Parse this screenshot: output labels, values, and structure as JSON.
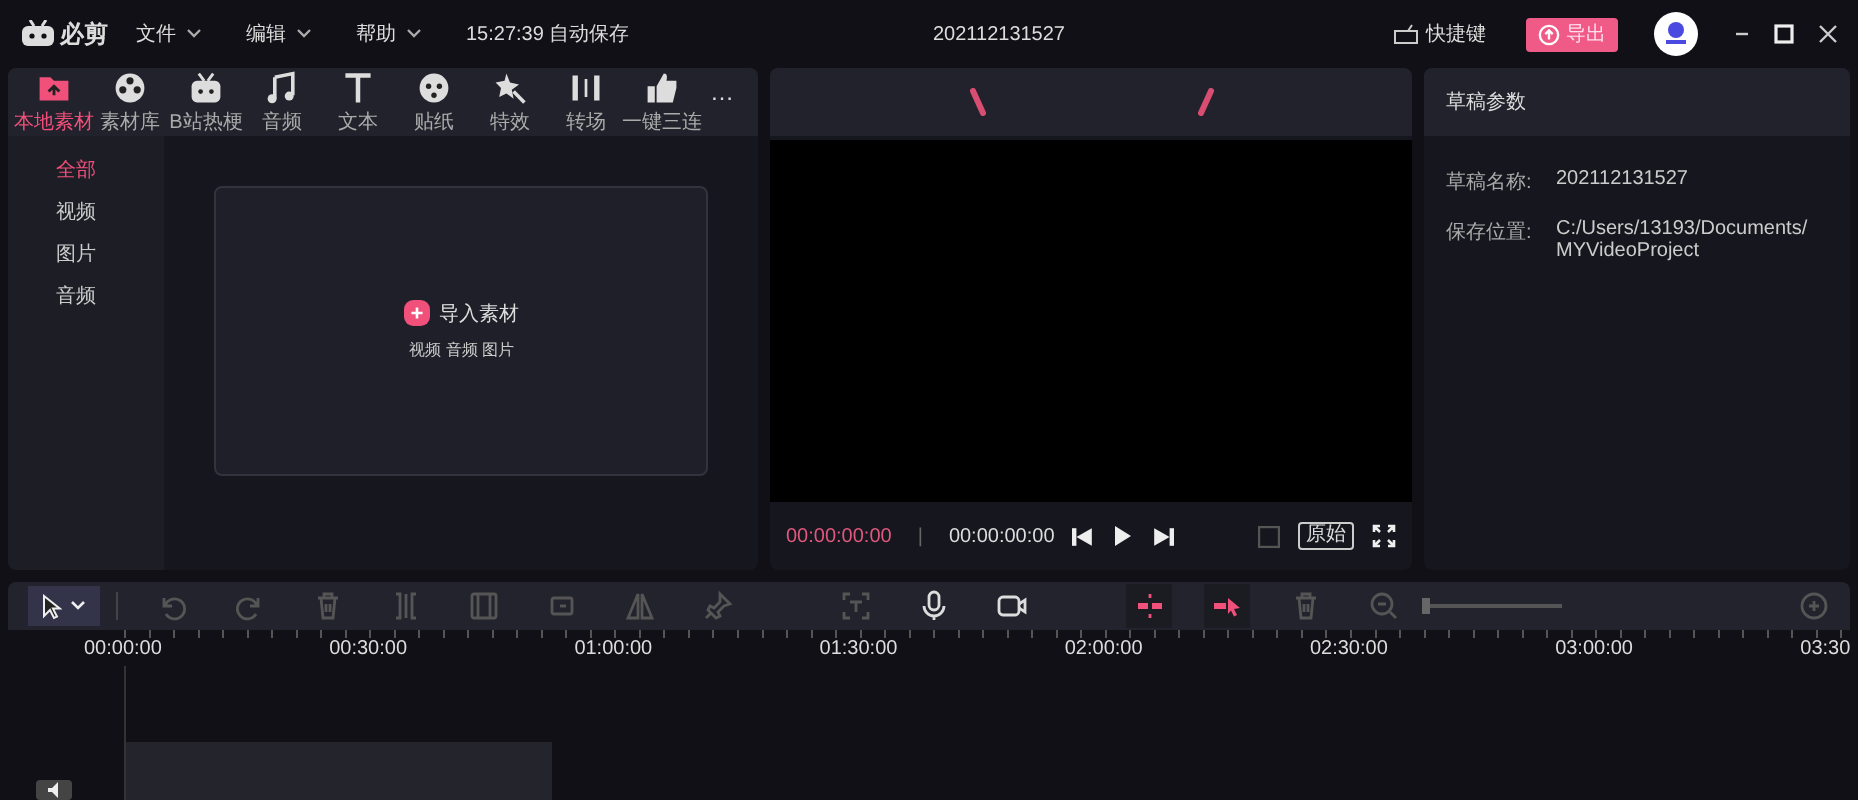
{
  "app": {
    "name": "必剪"
  },
  "menus": [
    {
      "label": "文件"
    },
    {
      "label": "编辑"
    },
    {
      "label": "帮助"
    }
  ],
  "autosave": "15:27:39 自动保存",
  "window": {
    "title": "202112131527"
  },
  "shortcuts": "快捷键",
  "export_button": "导出",
  "media_tabs": [
    {
      "label": "本地素材",
      "kind": "folder",
      "selected": true
    },
    {
      "label": "素材库",
      "kind": "reel",
      "selected": false
    },
    {
      "label": "B站热梗",
      "kind": "tv",
      "selected": false
    },
    {
      "label": "音频",
      "kind": "note",
      "selected": false
    },
    {
      "label": "文本",
      "kind": "text",
      "selected": false
    },
    {
      "label": "贴纸",
      "kind": "sticker",
      "selected": false
    },
    {
      "label": "特效",
      "kind": "wand",
      "selected": false
    },
    {
      "label": "转场",
      "kind": "transition",
      "selected": false
    },
    {
      "label": "一键三连",
      "kind": "thumb",
      "selected": false
    }
  ],
  "more": "…",
  "categories": [
    {
      "label": "全部",
      "selected": true
    },
    {
      "label": "视频",
      "selected": false
    },
    {
      "label": "图片",
      "selected": false
    },
    {
      "label": "音频",
      "selected": false
    }
  ],
  "import": {
    "label": "导入素材",
    "hint": "视频 音频 图片"
  },
  "player": {
    "current": "00:00:00:00",
    "separator": "|",
    "total": "00:00:00:00",
    "ratio": "原始"
  },
  "draft": {
    "title": "草稿参数",
    "rows": [
      {
        "label": "草稿名称:",
        "value": "202112131527"
      },
      {
        "label": "保存位置:",
        "value": "C:/Users/13193/Documents/ MYVideoProject"
      }
    ]
  },
  "tools": [
    {
      "kind": "undo",
      "disabled": true
    },
    {
      "kind": "redo",
      "disabled": true
    },
    {
      "kind": "delete",
      "disabled": true
    },
    {
      "kind": "split",
      "disabled": true
    },
    {
      "kind": "crop",
      "disabled": true
    },
    {
      "kind": "rotate",
      "disabled": true
    },
    {
      "kind": "mirror",
      "disabled": true
    },
    {
      "kind": "pin",
      "disabled": true
    },
    {
      "kind": "gap"
    },
    {
      "kind": "textframe",
      "disabled": true
    },
    {
      "kind": "mic",
      "disabled": false
    },
    {
      "kind": "camera",
      "disabled": false
    },
    {
      "kind": "gap"
    },
    {
      "kind": "snap",
      "disabled": false
    },
    {
      "kind": "linkcursor",
      "disabled": false
    },
    {
      "kind": "delete",
      "disabled": true
    },
    {
      "kind": "zoomout",
      "disabled": true
    }
  ],
  "zoom": {
    "level": 0.03
  },
  "ruler": [
    "00:00:00",
    "00:30:00",
    "01:00:00",
    "01:30:00",
    "02:00:00",
    "02:30:00",
    "03:00:00",
    "03:30"
  ]
}
